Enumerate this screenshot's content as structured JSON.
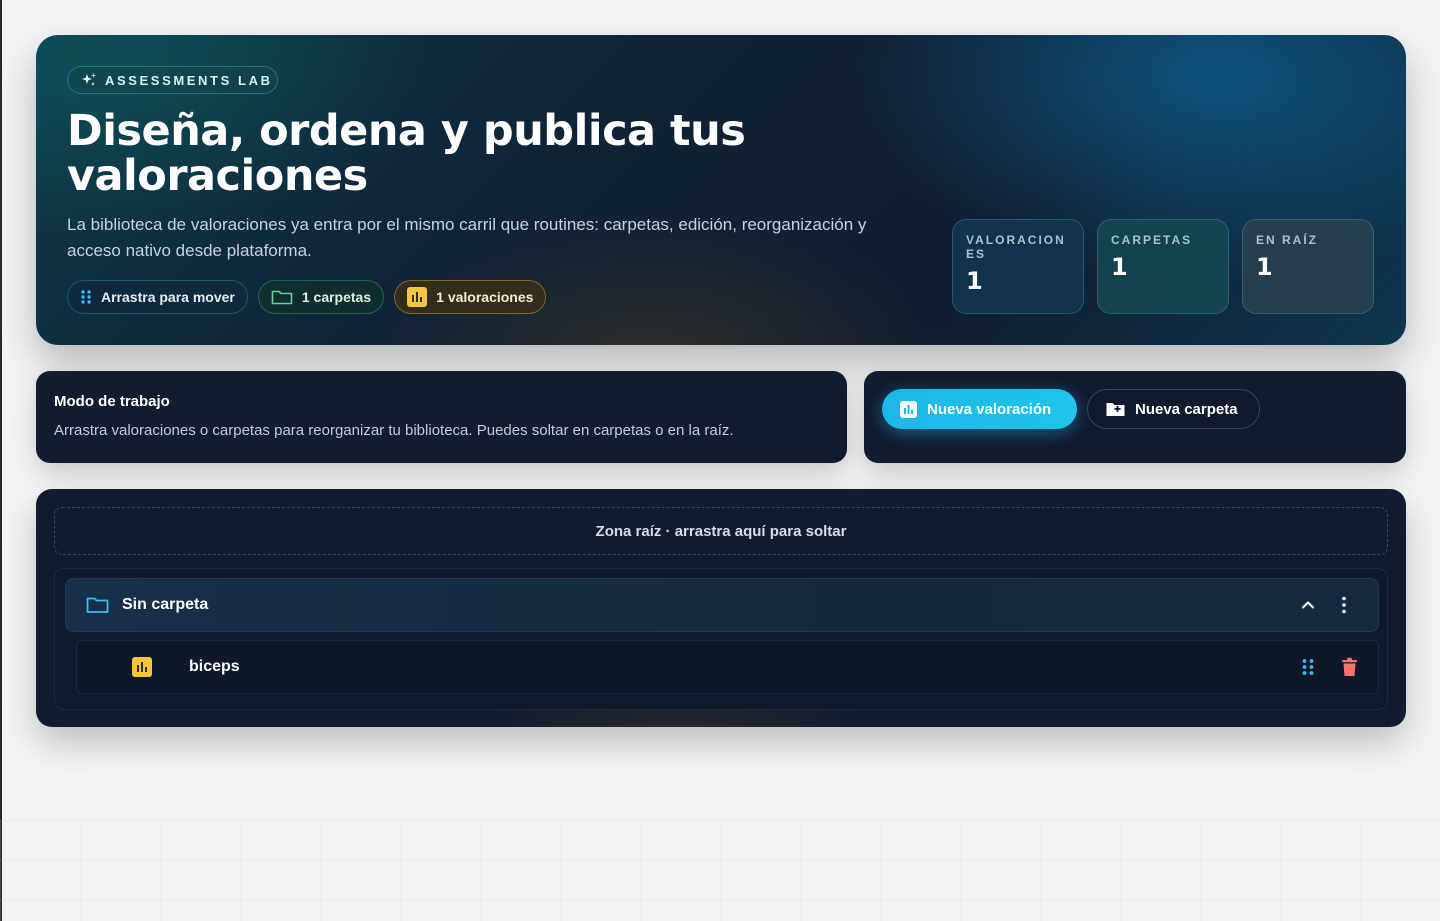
{
  "hero": {
    "badge": "ASSESSMENTS LAB",
    "title": "Diseña, ordena y publica tus valoraciones",
    "description": "La biblioteca de valoraciones ya entra por el mismo carril que routines: carpetas, edición, reorganización y acceso nativo desde plataforma.",
    "chips": {
      "drag": "Arrastra para mover",
      "folders": "1 carpetas",
      "assessments": "1 valoraciones"
    },
    "stats": [
      {
        "label": "VALORACION ES",
        "value": "1"
      },
      {
        "label": "CARPETAS",
        "value": "1"
      },
      {
        "label": "EN RAÍZ",
        "value": "1"
      }
    ]
  },
  "work_mode": {
    "title": "Modo de trabajo",
    "description": "Arrastra valoraciones o carpetas para reorganizar tu biblioteca. Puedes soltar en carpetas o en la raíz."
  },
  "actions": {
    "new_assessment": "Nueva valoración",
    "new_folder": "Nueva carpeta"
  },
  "library": {
    "root_zone": "Zona raíz · arrastra aquí para soltar",
    "folder": {
      "name": "Sin carpeta",
      "items": [
        {
          "name": "biceps"
        }
      ]
    }
  },
  "colors": {
    "accent": "#1fb6e8",
    "folder_icon": "#38bdf8",
    "chart_badge": "#f5c542",
    "delete": "#f87171",
    "drag_handle": "#38bdf8"
  },
  "icons": {
    "badge": "sparkles-icon",
    "drag": "grip-icon",
    "folder": "folder-icon",
    "chart": "bar-chart-icon",
    "folder_plus": "folder-plus-icon",
    "collapse": "chevron-up-icon",
    "more": "more-vertical-icon",
    "delete": "trash-icon"
  }
}
